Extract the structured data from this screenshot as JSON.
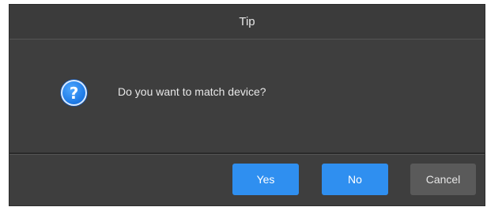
{
  "dialog": {
    "title": "Tip",
    "message": "Do you want to match device?",
    "icon": "question-icon",
    "icon_glyph": "?",
    "buttons": {
      "yes": "Yes",
      "no": "No",
      "cancel": "Cancel"
    }
  },
  "colors": {
    "dialog_background": "#3e3e3e",
    "primary_button": "#2f8ff0",
    "secondary_button": "#5a5a5a",
    "text": "#e8e8e8"
  }
}
